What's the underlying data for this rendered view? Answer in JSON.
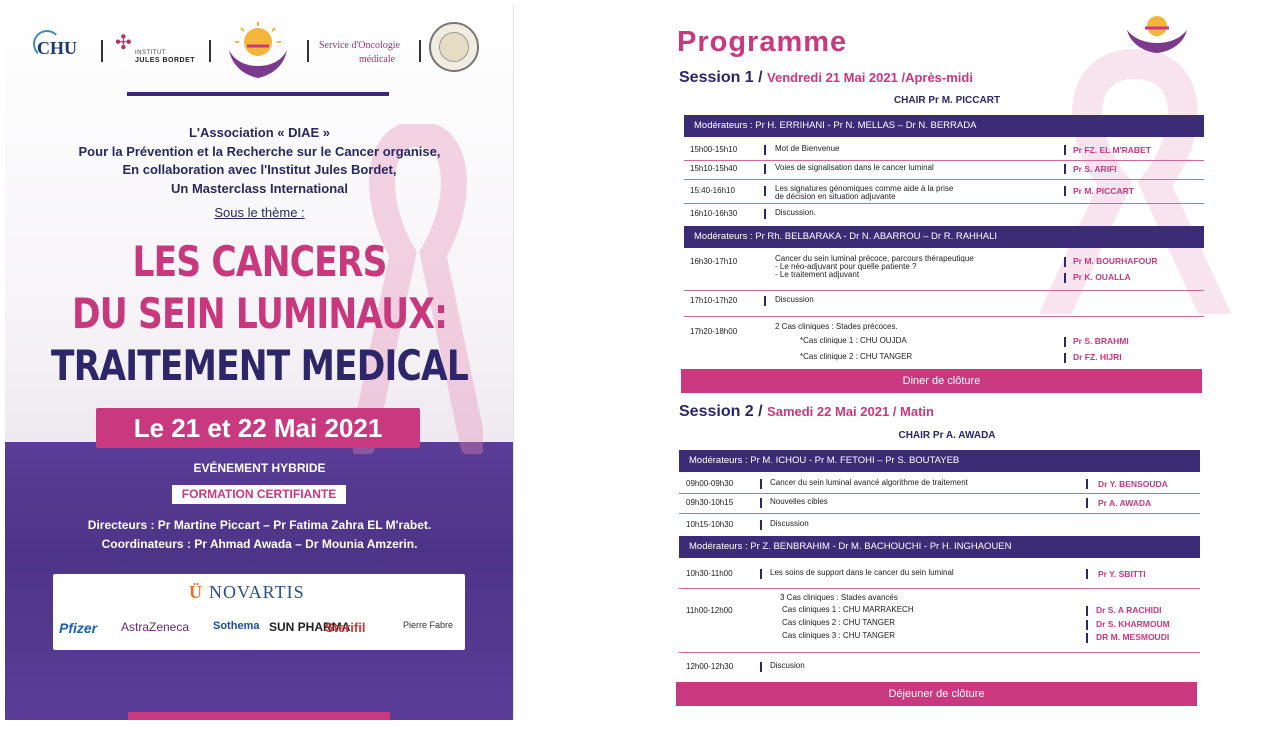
{
  "poster": {
    "logos": {
      "chu": "CHU",
      "ijb_line1": "INSTITUT",
      "ijb_line2": "JULES BORDET",
      "oncologie_line1": "Service d'Oncologie",
      "oncologie_line2": "médicale"
    },
    "intro": [
      "L'Association « DIAE »",
      "Pour la Prévention et la Recherche sur le Cancer organise,",
      "En collaboration avec l'Institut Jules Bordet,",
      "Un Masterclass International"
    ],
    "theme_label": "Sous le thème :",
    "title": [
      "LES CANCERS",
      "DU SEIN LUMINAUX:",
      "TRAITEMENT MEDICAL"
    ],
    "date": "Le 21 et 22 Mai 2021",
    "event_type": "EVÉNEMENT HYBRIDE",
    "formation": "FORMATION CERTIFIANTE",
    "directors": "Directeurs : Pr Martine Piccart – Pr Fatima Zahra EL M'rabet.",
    "coordinators": "Coordinateurs : Pr Ahmad Awada – Dr Mounia Amzerin.",
    "sponsors": {
      "novartis": "NOVARTIS",
      "pfizer": "Pfizer",
      "astrazeneca": "AstraZeneca",
      "sothema": "Sothema",
      "sun": "SUN PHARMA",
      "sterifil": "Sterifil",
      "pierre_fabre": "Pierre Fabre"
    }
  },
  "program": {
    "title": "Programme",
    "session1": {
      "label": "Session 1 /",
      "subtitle": "Vendredi 21 Mai 2021 /Après-midi",
      "chair": "CHAIR Pr M. PICCART",
      "mod1": "Modérateurs : Pr H. ERRIHANI - Pr N. MELLAS – Dr N. BERRADA",
      "rows1": [
        {
          "time": "15h00-15h10",
          "topic": "Mot de Bienvenue",
          "speaker": "Pr FZ. EL M'RABET"
        },
        {
          "time": "15h10-15h40",
          "topic": "Voies de signalisation dans le cancer luminal",
          "speaker": "Pr S. ARIFI"
        },
        {
          "time": "15:40-16h10",
          "topic1": "Les signatures génomiques comme aide à la prise",
          "topic2": "de décision  en situation adjuvante",
          "speaker": "Pr M. PICCART"
        },
        {
          "time": "16h10-16h30",
          "topic": "Discussion.",
          "speaker": ""
        }
      ],
      "mod2": "Modérateurs : Pr Rh. BELBARAKA - Dr N. ABARROU – Dr R. RAHHALI",
      "rows2": [
        {
          "time": "16h30-17h10",
          "topic1": "Cancer du sein luminal précoce, parcours thérapeutique",
          "topic2": "- Le néo-adjuvant pour quelle patiente ?",
          "topic3": "- Le traitement adjuvant",
          "speaker1": "Pr M. BOURHAFOUR",
          "speaker2": "Pr K. OUALLA"
        },
        {
          "time": "17h10-17h20",
          "topic": "Discussion"
        },
        {
          "time": "17h20-18h00",
          "topic": "2 Cas cliniques : Stades précoces.",
          "case1": "*Cas clinique 1   : CHU OUJDA",
          "case2": "*Cas clinique 2  : CHU TANGER",
          "speaker1": "Pr S. BRAHMI",
          "speaker2": "Dr FZ. HIJRI"
        }
      ],
      "closing": "Diner de clôture"
    },
    "session2": {
      "label": "Session 2 /",
      "subtitle": "Samedi 22 Mai 2021 / Matin",
      "chair": "CHAIR Pr A. AWADA",
      "mod1": "Modérateurs : Pr M. ICHOU - Pr M. FETOHI – Pr S. BOUTAYEB",
      "rows1": [
        {
          "time": "09h00-09h30",
          "topic": "Cancer du sein luminal avancé algorithme de traitement",
          "speaker": "Dr Y. BENSOUDA"
        },
        {
          "time": "09h30-10h15",
          "topic": "Nouvelles cibles",
          "speaker": "Pr A. AWADA"
        },
        {
          "time": "10h15-10h30",
          "topic": "Discussion",
          "speaker": ""
        }
      ],
      "mod2": "Modérateurs : Pr Z. BENBRAHIM - Dr M. BACHOUCHI - Pr H. INGHAOUEN",
      "rows2": [
        {
          "time": "10h30-11h00",
          "topic": "Les  soins de support dans le cancer du sein luminal",
          "speaker": "Pr Y. SBITTI"
        },
        {
          "time": "11h00-12h00",
          "topic": "3 Cas cliniques : Stades avancés",
          "case1": "Cas cliniques 1 : CHU MARRAKECH",
          "case2": "Cas cliniques 2 : CHU TANGER",
          "case3": "Cas cliniques 3 : CHU TANGER",
          "speaker1": "Dr S. A RACHIDI",
          "speaker2": "Dr S. KHARMOUM",
          "speaker3": "DR M. MESMOUDI"
        },
        {
          "time": "12h00-12h30",
          "topic": "Discusion"
        }
      ],
      "closing": "Déjeuner de clôture"
    }
  },
  "colors": {
    "magenta": "#c8397f",
    "navy": "#2d2668",
    "purple_bar": "#3c2b76",
    "poster_purple": "#4e3488"
  }
}
